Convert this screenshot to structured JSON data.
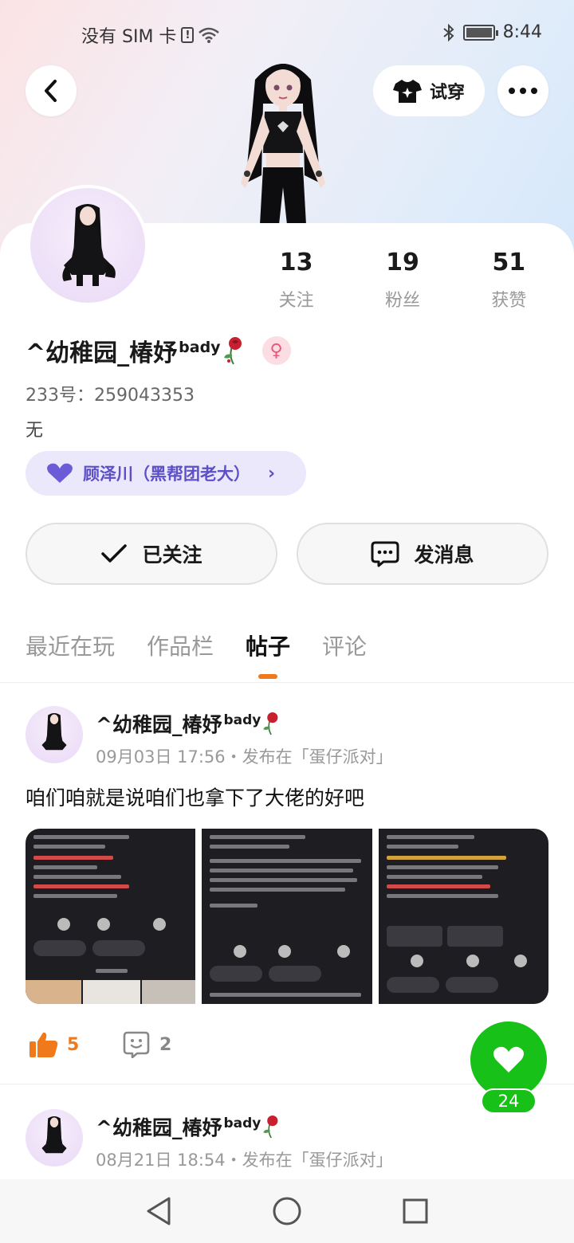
{
  "status_bar": {
    "carrier": "没有 SIM 卡",
    "time": "8:44"
  },
  "header": {
    "tryon_label": "试穿"
  },
  "profile": {
    "name": "^幼稚园_椿妤",
    "name_sup": "bady",
    "id_text": "233号：259043353",
    "bio": "无",
    "relation_label": "顾泽川（黑帮团老大）",
    "stats": [
      {
        "num": "13",
        "label": "关注"
      },
      {
        "num": "19",
        "label": "粉丝"
      },
      {
        "num": "51",
        "label": "获赞"
      }
    ]
  },
  "actions": {
    "follow_label": "已关注",
    "message_label": "发消息"
  },
  "tabs": [
    "最近在玩",
    "作品栏",
    "帖子",
    "评论"
  ],
  "posts": [
    {
      "author": "^幼稚园_椿妤",
      "author_sup": "bady",
      "meta": "09月03日 17:56・发布在「蛋仔派对」",
      "text": "咱们咱就是说咱们也拿下了大佬的好吧",
      "likes": "5",
      "comments": "2"
    },
    {
      "author": "^幼稚园_椿妤",
      "author_sup": "bady",
      "meta": "08月21日 18:54・发布在「蛋仔派对」"
    }
  ],
  "fab": {
    "count": "24"
  },
  "colors": {
    "accent": "#f07a1b",
    "green": "#17c117",
    "relation": "#5c4fc7"
  }
}
